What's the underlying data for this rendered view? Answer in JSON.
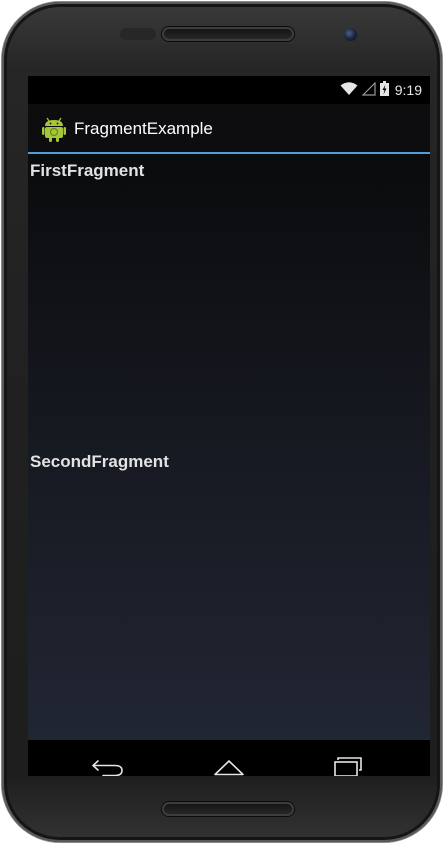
{
  "status_bar": {
    "time": "9:19",
    "icons": [
      "wifi-icon",
      "signal-icon",
      "battery-charging-icon"
    ]
  },
  "action_bar": {
    "app_icon": "android-app-icon",
    "title": "FragmentExample"
  },
  "content": {
    "first_fragment_label": "FirstFragment",
    "second_fragment_label": "SecondFragment"
  },
  "nav_bar": {
    "buttons": [
      "back-icon",
      "home-icon",
      "recents-icon"
    ]
  },
  "colors": {
    "action_bar_divider": "#4f9fd6",
    "android_green": "#a4c639",
    "text": "#e2e2e2"
  }
}
